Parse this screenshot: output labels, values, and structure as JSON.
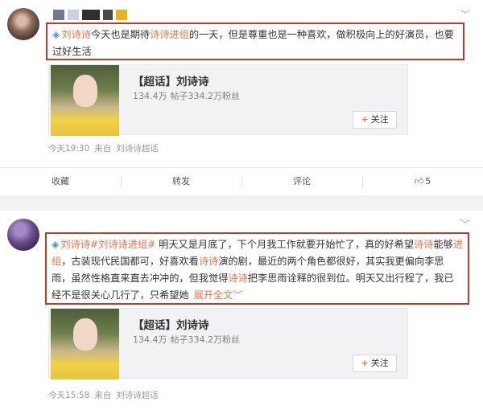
{
  "post1": {
    "text_prefix_link": "刘诗诗",
    "text_a": "今天也是期待",
    "text_b_link": "诗诗进组",
    "text_c": "的一天，但是尊重也是一种喜欢，做积极向上的好演员，也要过好生活",
    "card": {
      "title": "【超话】刘诗诗",
      "posts": "134.4万",
      "posts_fans_label": "帖子334.2万粉丝",
      "follow_label": "关注"
    },
    "time": "今天19:30",
    "source_label": "来自",
    "source": "刘诗诗超话"
  },
  "actions": {
    "collect": "收藏",
    "repost": "转发",
    "comment": "评论",
    "like_count": "5"
  },
  "post2": {
    "tag1": "刘诗诗#",
    "tag2": "刘诗诗进组#",
    "text_a": " 明天又是月底了，下个月我工作就要开始忙了，真的好希望",
    "link_a": "诗诗",
    "text_b": "能够",
    "link_b": "进组",
    "text_c": "，古装现代民国都可，好喜欢看",
    "link_c": "诗诗",
    "text_d": "演的剧，最近的两个角色都很好，其实我更偏向李思雨，虽然性格直来直去冲冲的，但我觉得",
    "link_d": "诗诗",
    "text_e": "把李思雨诠释的很到位。明天又出行程了，我已经不是很关心几行了，只希望她",
    "expand": "展开全文",
    "card": {
      "title": "【超话】刘诗诗",
      "posts": "134.4万",
      "posts_fans_label": "帖子334.2万粉丝",
      "follow_label": "关注"
    },
    "time": "今天15:58",
    "source_label": "来自",
    "source": "刘诗诗超话"
  },
  "colors": {
    "highlight_border": "#c0392b",
    "link": "#eb7350",
    "pin": "#4a90c8"
  }
}
